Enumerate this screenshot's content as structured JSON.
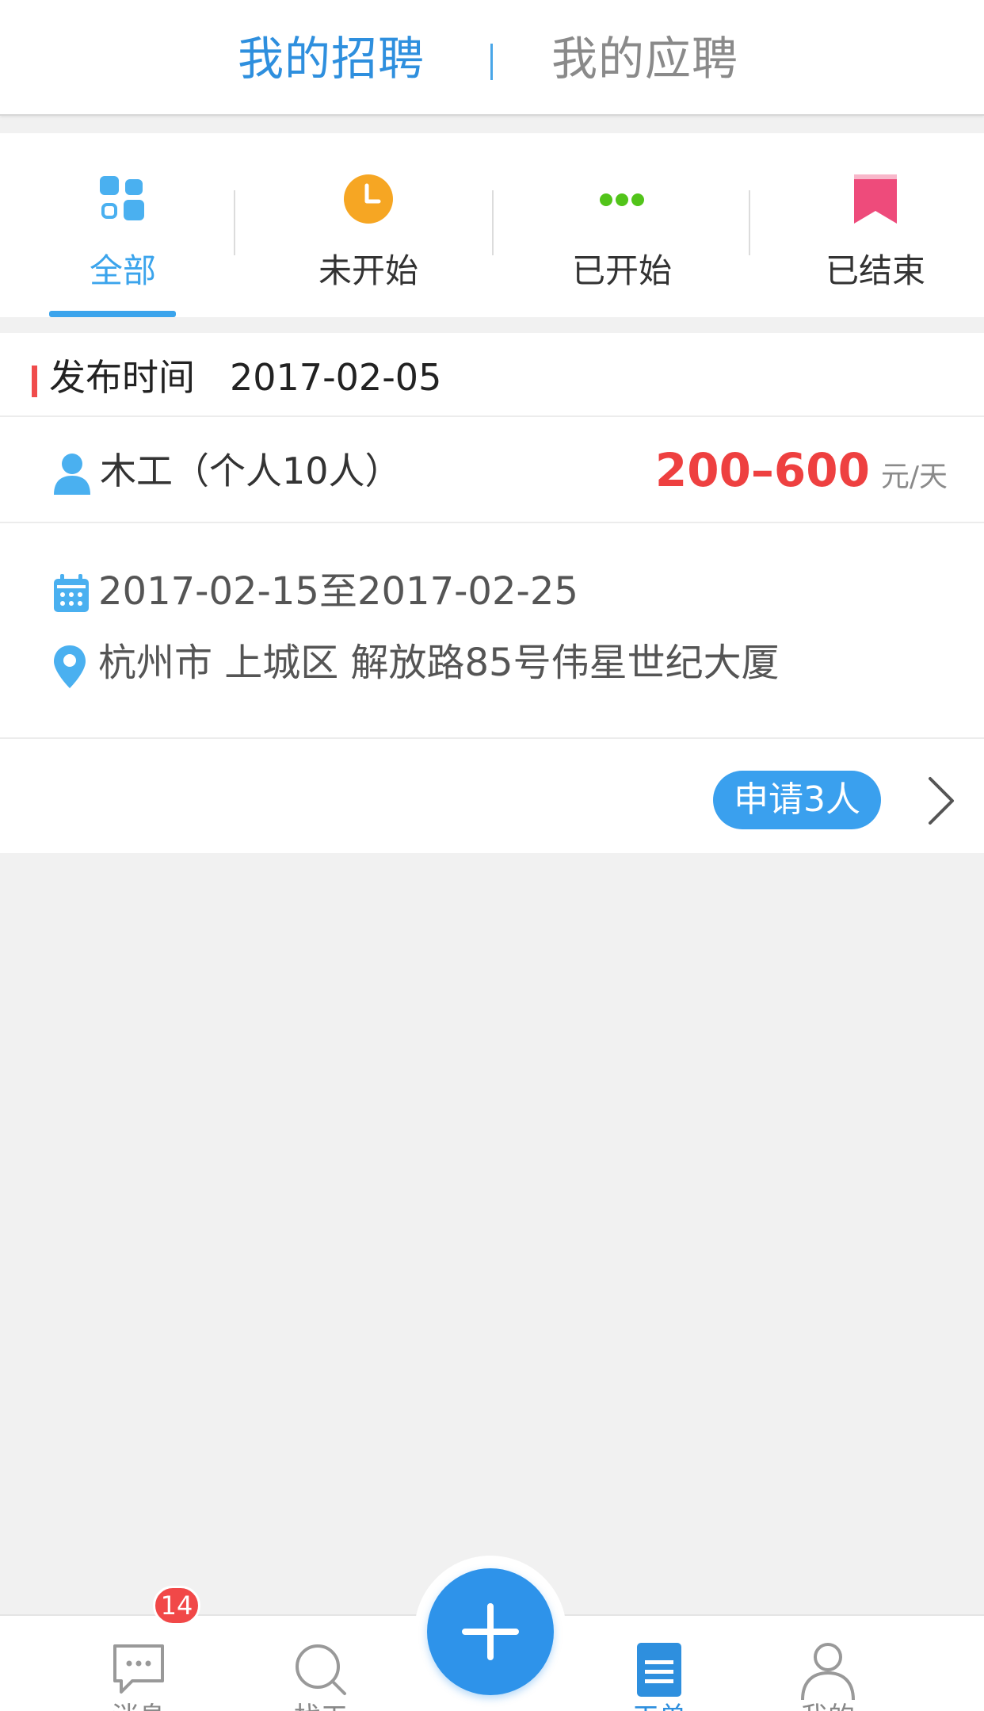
{
  "header": {
    "tabs": [
      {
        "label": "我的招聘",
        "active": true
      },
      {
        "label": "我的应聘",
        "active": false
      }
    ]
  },
  "filters": {
    "items": [
      {
        "label": "全部",
        "icon": "grid-icon",
        "active": true
      },
      {
        "label": "未开始",
        "icon": "clock-icon",
        "active": false
      },
      {
        "label": "已开始",
        "icon": "dots-icon",
        "active": false
      },
      {
        "label": "已结束",
        "icon": "bookmark-icon",
        "active": false
      }
    ]
  },
  "card": {
    "publish_label": "发布时间",
    "publish_date": "2017-02-05",
    "job_title": "木工（个人10人）",
    "salary": "200–600",
    "salary_unit": "元/天",
    "date_range": "2017-02-15至2017-02-25",
    "address": "杭州市 上城区 解放路85号伟星世纪大厦",
    "apply_button": "申请3人"
  },
  "tabbar": {
    "items": [
      {
        "label": "消息",
        "icon": "chat-icon",
        "badge": "14"
      },
      {
        "label": "找工",
        "icon": "search-icon"
      },
      {
        "label": "",
        "icon": "plus-icon"
      },
      {
        "label": "工单",
        "icon": "list-icon",
        "active": true
      },
      {
        "label": "我的",
        "icon": "user-icon"
      }
    ]
  },
  "colors": {
    "accent": "#2e8fde",
    "salary": "#ee4040",
    "apply_button": "#3aa0ee",
    "clock": "#f6a623",
    "dots": "#52c41a",
    "bookmark": "#ee4b7b"
  }
}
